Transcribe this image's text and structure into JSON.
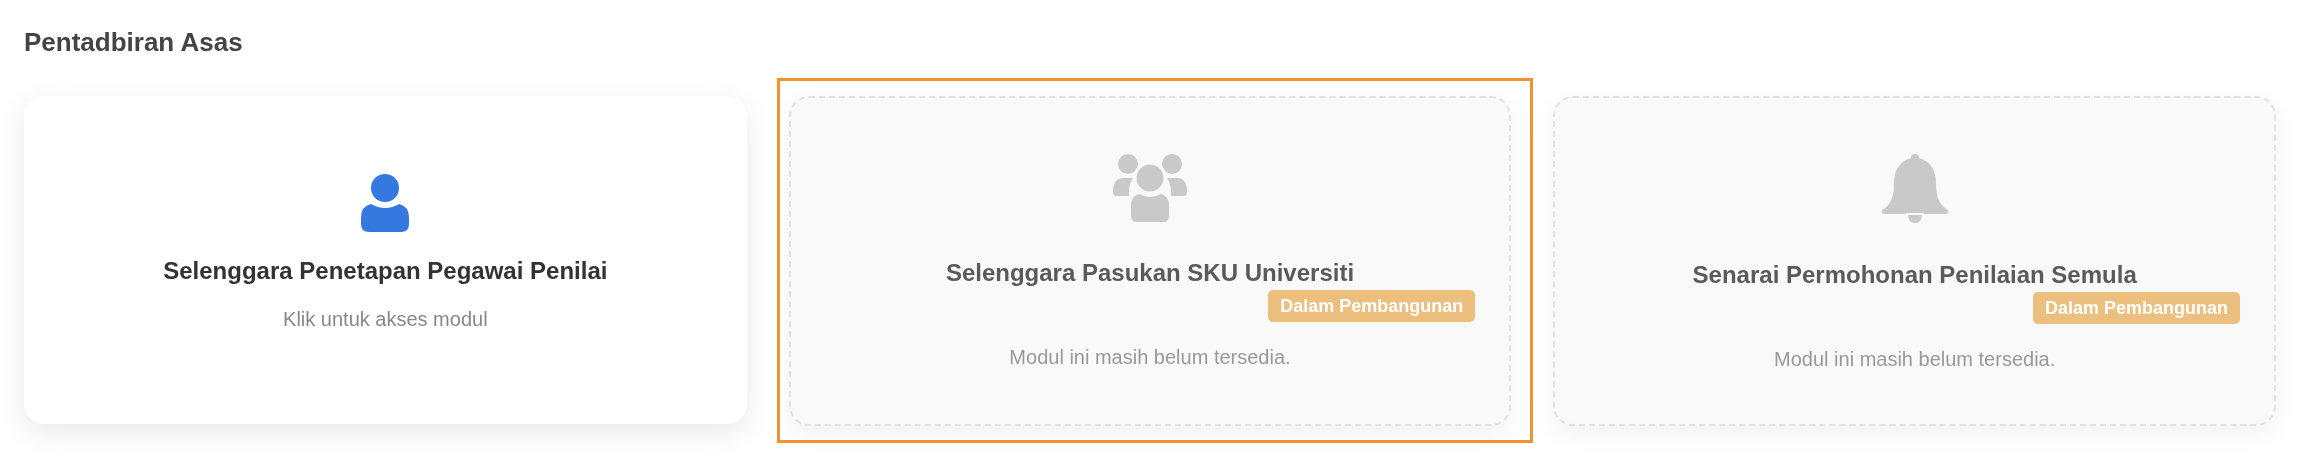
{
  "section_title": "Pentadbiran Asas",
  "modules": [
    {
      "kind": "person",
      "title": "Selenggara Penetapan Pegawai Penilai",
      "subtitle": "Klik untuk akses modul",
      "disabled": false,
      "highlighted": false
    },
    {
      "kind": "group",
      "title": "Selenggara Pasukan SKU Universiti",
      "badge": "Dalam Pembangunan",
      "subtitle": "Modul ini masih belum tersedia.",
      "disabled": true,
      "highlighted": true
    },
    {
      "kind": "bell",
      "title": "Senarai Permohonan Penilaian Semula",
      "badge": "Dalam Pembangunan",
      "subtitle": "Modul ini masih belum tersedia.",
      "disabled": true,
      "highlighted": false
    }
  ]
}
